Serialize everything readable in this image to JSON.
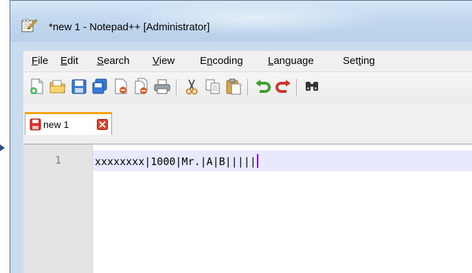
{
  "window": {
    "title": "*new 1 - Notepad++ [Administrator]",
    "app_icon": "notepad-icon"
  },
  "menu": {
    "items": [
      {
        "label": "File",
        "underline": "F"
      },
      {
        "label": "Edit",
        "underline": "E"
      },
      {
        "label": "Search",
        "underline": "S"
      },
      {
        "label": "View",
        "underline": "V"
      },
      {
        "label": "Encoding",
        "underline": "n"
      },
      {
        "label": "Language",
        "underline": "L"
      },
      {
        "label": "Setting",
        "underline": "t"
      }
    ]
  },
  "toolbar": {
    "buttons": [
      "new-file-icon",
      "open-file-icon",
      "save-icon",
      "save-all-icon",
      "close-icon",
      "close-all-icon",
      "print-icon",
      "cut-icon",
      "copy-icon",
      "paste-icon",
      "undo-icon",
      "redo-icon",
      "find-icon"
    ]
  },
  "tabs": [
    {
      "label": "new 1",
      "modified": true,
      "active": true
    }
  ],
  "editor": {
    "line_number": "1",
    "line_text": "xxxxxxxx|1000|Mr.|A|B|||||"
  },
  "colors": {
    "tab_accent": "#f6a30a",
    "current_line": "#e8e8ff",
    "caret": "#8000ff",
    "gutter": "#e4e4e4"
  }
}
